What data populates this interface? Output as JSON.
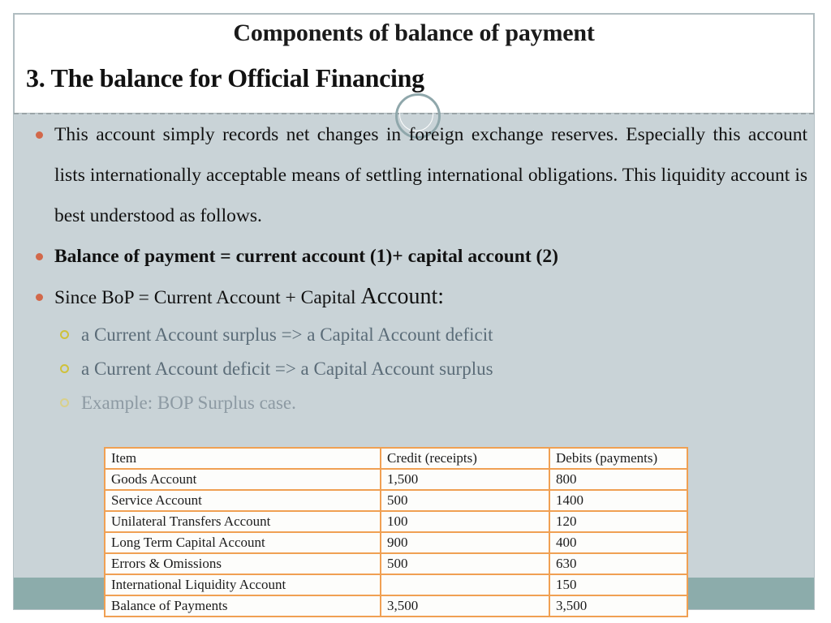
{
  "slide": {
    "title": "Components of balance of payment",
    "section_heading": "3. The balance for Official Financing",
    "accent_orange": "#d2684a",
    "accent_table_border": "#f0a053",
    "bg_body": "#c9d3d7",
    "bg_footer": "#8cacab"
  },
  "bullets": {
    "b1": "This account simply records net changes in foreign exchange reserves. Especially this account lists internationally acceptable means of settling international obligations. This liquidity account is best understood as follows.",
    "b2": "Balance of payment = current account (1)+ capital account (2)",
    "b3_a": "Since BoP = Current Account + Capital ",
    "b3_b": "Account:",
    "s1": "a Current Account surplus => a Capital Account deficit",
    "s2": "a Current Account deficit => a Capital Account surplus",
    "s3": "Example: BOP Surplus case."
  },
  "table": {
    "headers": [
      "Item",
      "Credit (receipts)",
      "Debits (payments)"
    ],
    "rows": [
      [
        "Goods Account",
        "1,500",
        "800"
      ],
      [
        "Service Account",
        "500",
        "1400"
      ],
      [
        "Unilateral Transfers Account",
        "100",
        "120"
      ],
      [
        "Long Term Capital Account",
        "900",
        "400"
      ],
      [
        "Errors & Omissions",
        "500",
        "630"
      ],
      [
        "International Liquidity Account",
        "",
        "150"
      ],
      [
        "Balance of Payments",
        "3,500",
        "3,500"
      ]
    ]
  }
}
